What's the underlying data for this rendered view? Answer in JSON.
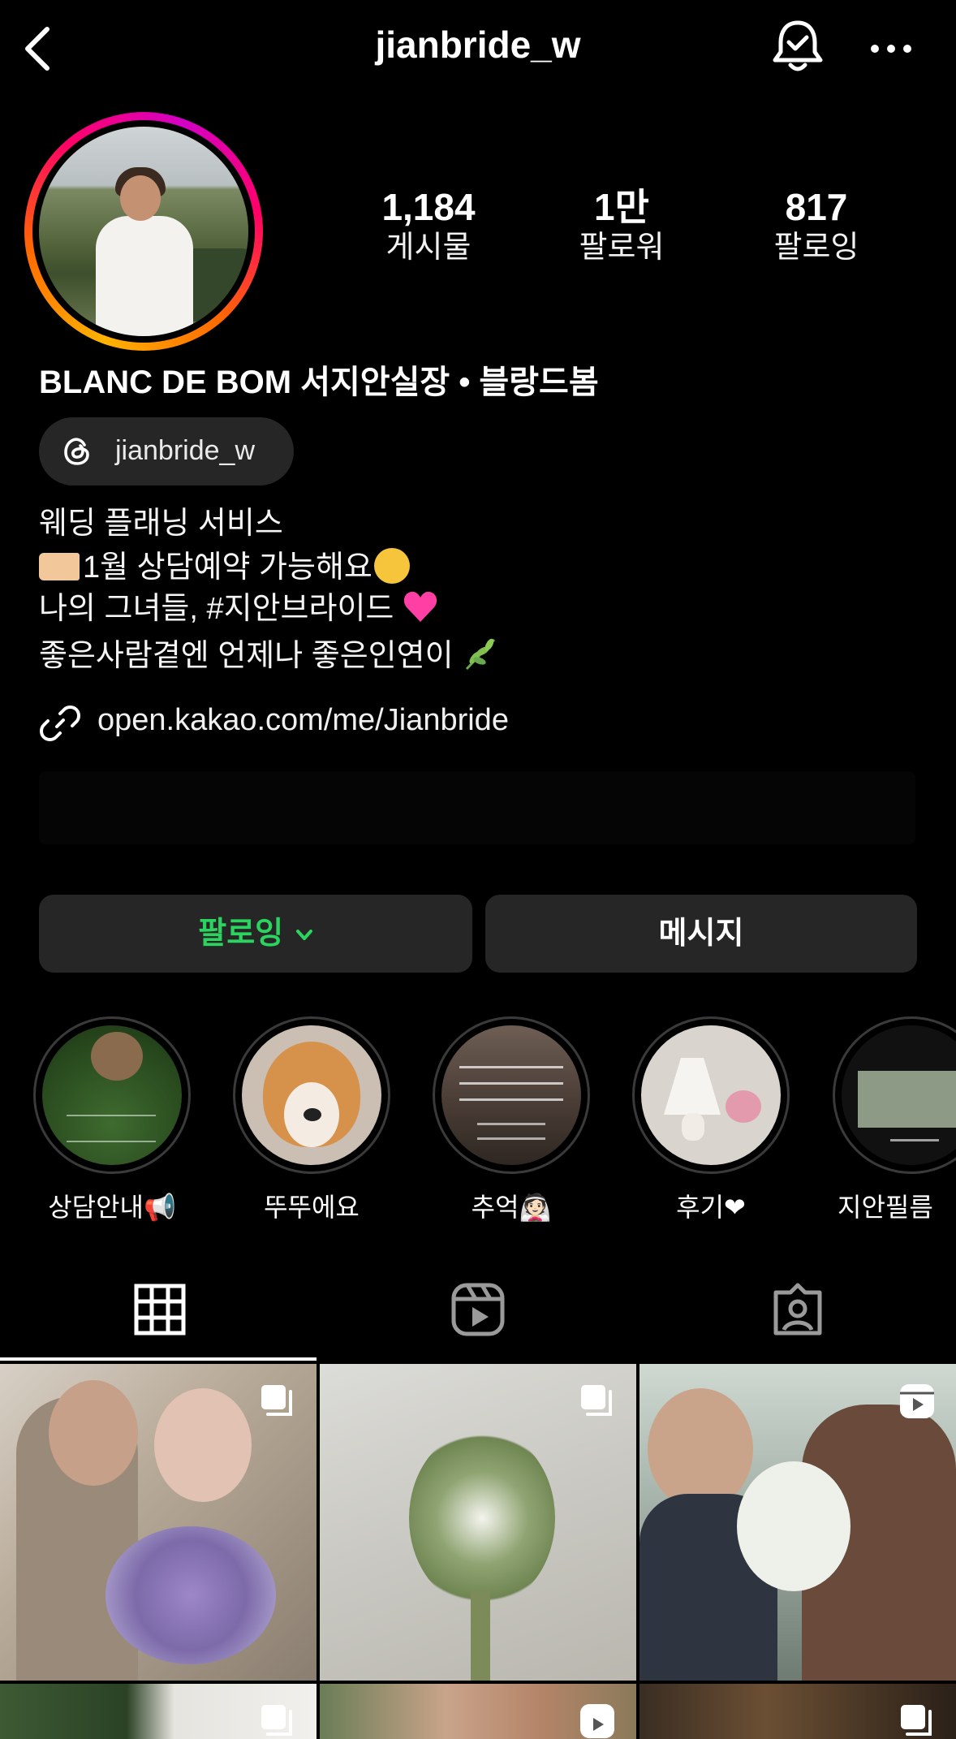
{
  "header": {
    "username": "jianbride_w",
    "back_icon": "chevron-left-icon",
    "notification_icon": "bell-check-icon",
    "more_icon": "more-horizontal-icon"
  },
  "profile": {
    "stats": [
      {
        "value": "1,184",
        "label": "게시물"
      },
      {
        "value": "1만",
        "label": "팔로워"
      },
      {
        "value": "817",
        "label": "팔로잉"
      }
    ],
    "display_name": "BLANC DE BOM 서지안실장 • 블랑드봄",
    "threads_handle": "jianbride_w",
    "bio": {
      "line1": "웨딩 플래닝 서비스",
      "line2": "1월 상담예약 가능해요",
      "line3": "나의 그녀들, #지안브라이드",
      "line4": "좋은사람곁엔 언제나 좋은인연이"
    },
    "link": "open.kakao.com/me/Jianbride"
  },
  "actions": {
    "follow_label": "팔로잉",
    "message_label": "메시지",
    "accent_color": "#2bd35f"
  },
  "highlights": [
    {
      "label": "상담안내📢"
    },
    {
      "label": "뚜뚜에요"
    },
    {
      "label": "추억👰🏻"
    },
    {
      "label": "후기❤"
    },
    {
      "label": "지안필름"
    }
  ],
  "tabs": [
    {
      "icon": "grid-icon",
      "selected": true
    },
    {
      "icon": "reels-icon",
      "selected": false
    },
    {
      "icon": "tagged-icon",
      "selected": false
    }
  ]
}
